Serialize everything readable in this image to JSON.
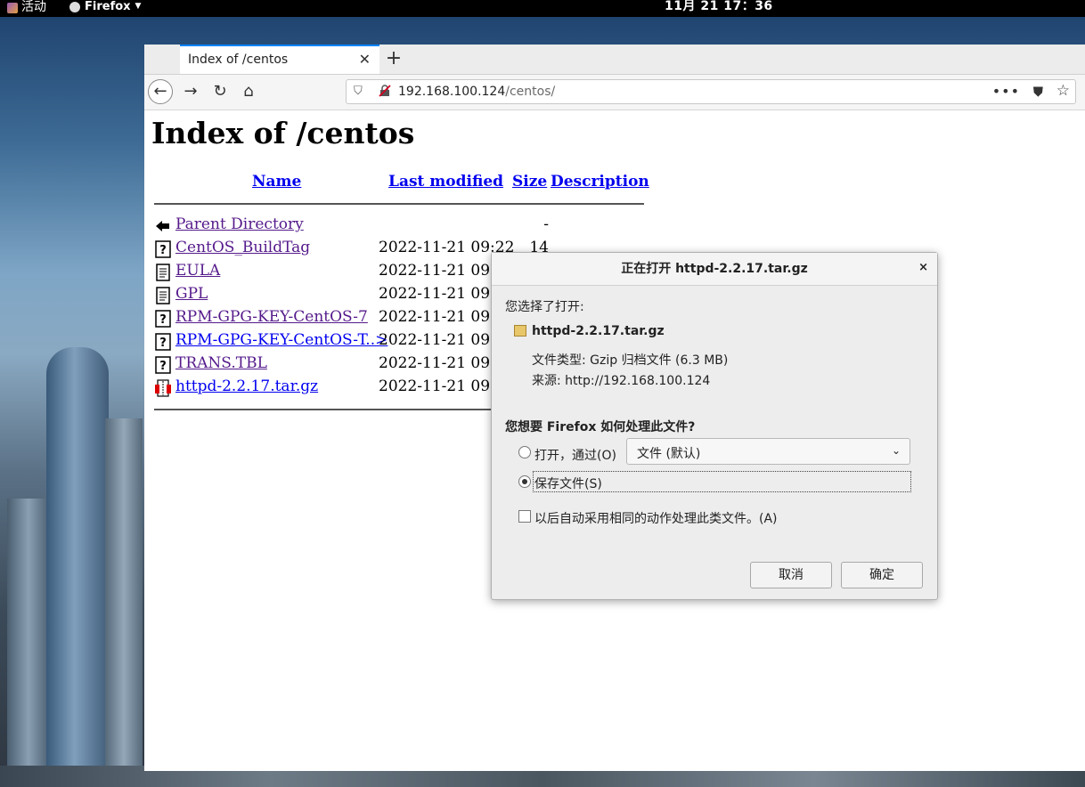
{
  "topbar": {
    "activities": "活动",
    "app": "Firefox",
    "clock": "11月 21  17：36"
  },
  "browser": {
    "tab_title": "Index of /centos",
    "tab_close": "✕",
    "new_tab": "+",
    "url_host": "192.168.100.124",
    "url_path": "/centos/"
  },
  "page": {
    "heading": "Index of /centos",
    "columns": {
      "name": "Name",
      "modified": "Last modified",
      "size": "Size",
      "description": "Description"
    },
    "rows": [
      {
        "name": "Parent Directory",
        "modified": "",
        "size": "-",
        "icon": "back-icon",
        "visited": true
      },
      {
        "name": "CentOS_BuildTag",
        "modified": "2022-11-21 09:22",
        "size": "14",
        "icon": "unknown-file-icon",
        "visited": true
      },
      {
        "name": "EULA",
        "modified": "2022-11-21 09:2",
        "size": "",
        "icon": "text-file-icon",
        "visited": true
      },
      {
        "name": "GPL",
        "modified": "2022-11-21 09:2",
        "size": "",
        "icon": "text-file-icon",
        "visited": true
      },
      {
        "name": "RPM-GPG-KEY-CentOS-7",
        "modified": "2022-11-21 09:2",
        "size": "",
        "icon": "unknown-file-icon",
        "visited": true
      },
      {
        "name": "RPM-GPG-KEY-CentOS-T..>",
        "modified": "2022-11-21 09:2",
        "size": "",
        "icon": "unknown-file-icon",
        "visited": false
      },
      {
        "name": "TRANS.TBL",
        "modified": "2022-11-21 09:2",
        "size": "",
        "icon": "unknown-file-icon",
        "visited": true
      },
      {
        "name": "httpd-2.2.17.tar.gz",
        "modified": "2022-11-21 09:3",
        "size": "",
        "icon": "compressed-file-icon",
        "visited": false
      }
    ]
  },
  "dialog": {
    "title": "正在打开 httpd-2.2.17.tar.gz",
    "close": "×",
    "chosen_label": "您选择了打开:",
    "filename": "httpd-2.2.17.tar.gz",
    "file_type": "文件类型:   Gzip 归档文件 (6.3 MB)",
    "source": "来源:   http://192.168.100.124",
    "question": "您想要 Firefox 如何处理此文件?",
    "open_with_label": "打开，通过(O)",
    "open_with_value": "文件 (默认)",
    "save_label": "保存文件(S)",
    "auto_label": "以后自动采用相同的动作处理此类文件。(A)",
    "cancel": "取消",
    "ok": "确定",
    "selected_option": "save",
    "auto_checked": false
  }
}
